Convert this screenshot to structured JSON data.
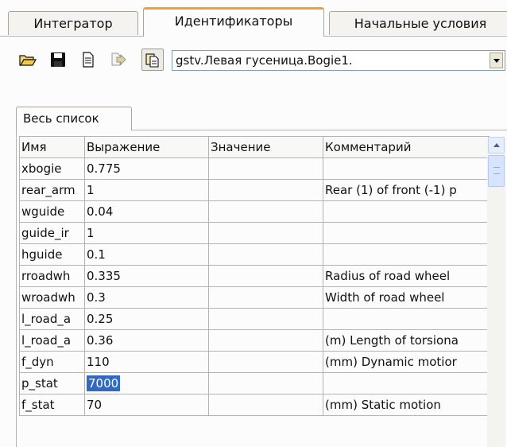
{
  "tabs": [
    {
      "label": "Интегратор",
      "active": false
    },
    {
      "label": "Идентификаторы",
      "active": true
    },
    {
      "label": "Начальные условия",
      "active": false
    }
  ],
  "toolbar": {
    "icons": [
      "open-folder-icon",
      "save-icon",
      "document-icon",
      "forward-arrow-icon",
      "copy-icon"
    ],
    "combo_value": "gstv.Левая гусеница.Bogie1."
  },
  "subtab": {
    "label": "Весь список"
  },
  "table": {
    "columns": [
      "Имя",
      "Выражение",
      "Значение",
      "Комментарий"
    ],
    "rows": [
      {
        "name": "xbogie",
        "expr": "0.775",
        "value": "",
        "comment": ""
      },
      {
        "name": "rear_arm",
        "expr": "1",
        "value": "",
        "comment": "Rear (1)  of front (-1) p"
      },
      {
        "name": "wguide",
        "expr": "0.04",
        "value": "",
        "comment": ""
      },
      {
        "name": "guide_ir",
        "expr": "1",
        "value": "",
        "comment": ""
      },
      {
        "name": "hguide",
        "expr": "0.1",
        "value": "",
        "comment": ""
      },
      {
        "name": "rroadwh",
        "expr": "0.335",
        "value": "",
        "comment": "Radius of road wheel"
      },
      {
        "name": "wroadwh",
        "expr": "0.3",
        "value": "",
        "comment": "Width of road wheel"
      },
      {
        "name": "l_road_a",
        "expr": "0.25",
        "value": "",
        "comment": ""
      },
      {
        "name": "l_road_a",
        "expr": "0.36",
        "value": "",
        "comment": "(m) Length of torsiona"
      },
      {
        "name": "f_dyn",
        "expr": "110",
        "value": "",
        "comment": "(mm) Dynamic motior"
      },
      {
        "name": "p_stat",
        "expr": "7000",
        "value": "",
        "comment": "",
        "selected": true
      },
      {
        "name": "f_stat",
        "expr": "70",
        "value": "",
        "comment": "(mm) Static motion"
      }
    ]
  },
  "colors": {
    "selection": "#316ac5",
    "active_tab_accent": "#f0a030"
  }
}
